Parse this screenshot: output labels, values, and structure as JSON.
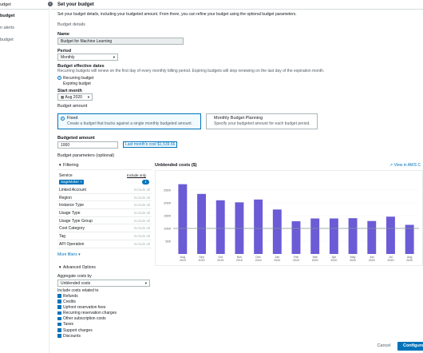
{
  "nav": {
    "items": [
      {
        "label": "udget"
      },
      {
        "label": "budget"
      },
      {
        "label": "n alerts"
      },
      {
        "label": "budget"
      }
    ]
  },
  "page": {
    "title": "Set your budget",
    "intro": "Set your budget details, including your budgeted amount. From there, you can refine your budget using the optional budget parameters.",
    "details_heading": "Budget details"
  },
  "form": {
    "name_label": "Name",
    "name_value": "Budget for Machine Learning",
    "period_label": "Period",
    "period_value": "Monthly",
    "effective_label": "Budget effective dates",
    "effective_desc": "Recurring budgets will renew on the first day of every monthly billing period. Expiring budgets will stop renewing on the last day of the expiration month.",
    "recurring_label": "Recurring budget",
    "expiring_label": "Expiring budget",
    "start_label": "Start month",
    "start_value": "Aug 2020",
    "amount_heading": "Budget amount",
    "fixed_title": "Fixed",
    "fixed_desc": "Create a budget that tracks against a single monthly budgeted amount.",
    "planning_title": "Monthly Budget Planning",
    "planning_desc": "Specify your budgeted amount for each budget period.",
    "budgeted_label": "Budgeted amount",
    "budgeted_value": "1000",
    "last_cost": "Last month's cost $1,539.66",
    "params_heading": "Budget parameters (optional)"
  },
  "filters": {
    "heading": "Filtering",
    "service_label": "Service",
    "include_only": "Include only",
    "selected_chip": "SageMaker",
    "selected_count": "1",
    "rows": [
      {
        "name": "Linked Account",
        "inc": "Include all"
      },
      {
        "name": "Region",
        "inc": "Include all"
      },
      {
        "name": "Instance Type",
        "inc": "Include all"
      },
      {
        "name": "Usage Type",
        "inc": "Include all"
      },
      {
        "name": "Usage Type Group",
        "inc": "Include all"
      },
      {
        "name": "Cost Category",
        "inc": "Include all"
      },
      {
        "name": "Tag",
        "inc": "Include all"
      },
      {
        "name": "API Operation",
        "inc": "Include all"
      }
    ],
    "more_filters": "More filters"
  },
  "advanced": {
    "heading": "Advanced Options",
    "aggregate_label": "Aggregate costs by",
    "aggregate_value": "Unblended costs",
    "include_label": "Include costs related to",
    "checks": [
      "Refunds",
      "Credits",
      "Upfront reservation fees",
      "Recurring reservation charges",
      "Other subscription costs",
      "Taxes",
      "Support charges",
      "Discounts"
    ]
  },
  "chart": {
    "title": "Unblended costs ($)",
    "view_link": "View in AWS C"
  },
  "chart_data": {
    "type": "bar",
    "categories": [
      "Aug 2019",
      "Sep 2019",
      "Oct 2019",
      "Nov 2019",
      "Dec 2019",
      "Jan 2020",
      "Feb 2020",
      "Mar 2020",
      "Apr 2020",
      "May 2020",
      "Jun 2020",
      "Jul 2020",
      "Aug 2020"
    ],
    "values": [
      2730,
      2350,
      2100,
      2020,
      2130,
      1740,
      1280,
      1390,
      1390,
      1400,
      1290,
      1460,
      1140
    ],
    "yticks": [
      "2500",
      "2000",
      "1500",
      "1000",
      "500"
    ],
    "xtick_labels": [
      [
        "Aug",
        "2019"
      ],
      [
        "Sep",
        "2019"
      ],
      [
        "Oct",
        "2019"
      ],
      [
        "Nov",
        "2019"
      ],
      [
        "Dec",
        "2019"
      ],
      [
        "Jan",
        "2020"
      ],
      [
        "Feb",
        "2020"
      ],
      [
        "Mar",
        "2020"
      ],
      [
        "Apr",
        "2020"
      ],
      [
        "May",
        "2020"
      ],
      [
        "Jun",
        "2020"
      ],
      [
        "Jul",
        "2020"
      ],
      [
        "Aug",
        "2020"
      ]
    ],
    "ylim": [
      0,
      3000
    ],
    "budget_line": 1000,
    "bar_color": "#6b5bd6"
  },
  "footer": {
    "cancel": "Cancel",
    "primary": "Configure"
  },
  "colors": {
    "accent": "#0073bb"
  }
}
